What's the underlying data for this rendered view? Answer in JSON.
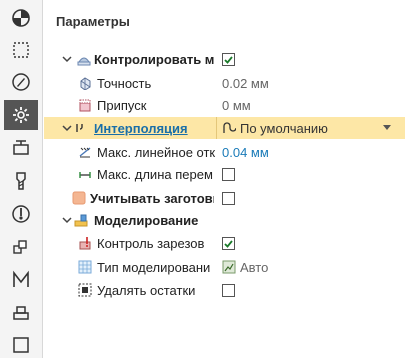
{
  "panel": {
    "title": "Параметры"
  },
  "sidebar": {
    "items": [
      {
        "icon": "pie-chart-icon"
      },
      {
        "icon": "dashed-selection-icon"
      },
      {
        "icon": "compass-edit-icon"
      },
      {
        "icon": "gear-icon",
        "active": true
      },
      {
        "icon": "stock-box-icon"
      },
      {
        "icon": "tool-icon"
      },
      {
        "icon": "probe-icon"
      },
      {
        "icon": "cubes-icon"
      },
      {
        "icon": "m-macro-icon"
      },
      {
        "icon": "stack-icon"
      },
      {
        "icon": "square-icon"
      }
    ]
  },
  "tree": {
    "control_model": {
      "label": "Контролировать мо,",
      "checked": true
    },
    "accuracy": {
      "label": "Точность",
      "value": "0.02 мм"
    },
    "allowance": {
      "label": "Припуск",
      "value": "0 мм"
    },
    "interpolation": {
      "label": "Интерполяция",
      "value": "По умолчанию"
    },
    "max_linear": {
      "label": "Макс. линейное отк",
      "value": "0.04 мм"
    },
    "max_length": {
      "label": "Макс. длина перем",
      "checked": false
    },
    "consider_stock": {
      "label": "Учитывать заготовк",
      "checked": false
    },
    "modeling": {
      "label": "Моделирование"
    },
    "gouge_control": {
      "label": "Контроль зарезов",
      "checked": true
    },
    "model_type": {
      "label": "Тип моделировани",
      "value": "Авто"
    },
    "remove_leftovers": {
      "label": "Удалять остатки",
      "checked": false
    }
  },
  "colors": {
    "selection": "#fde7a6",
    "link": "#1a6fa8",
    "value_blue": "#1a7bb8",
    "active_sidebar": "#555555"
  }
}
